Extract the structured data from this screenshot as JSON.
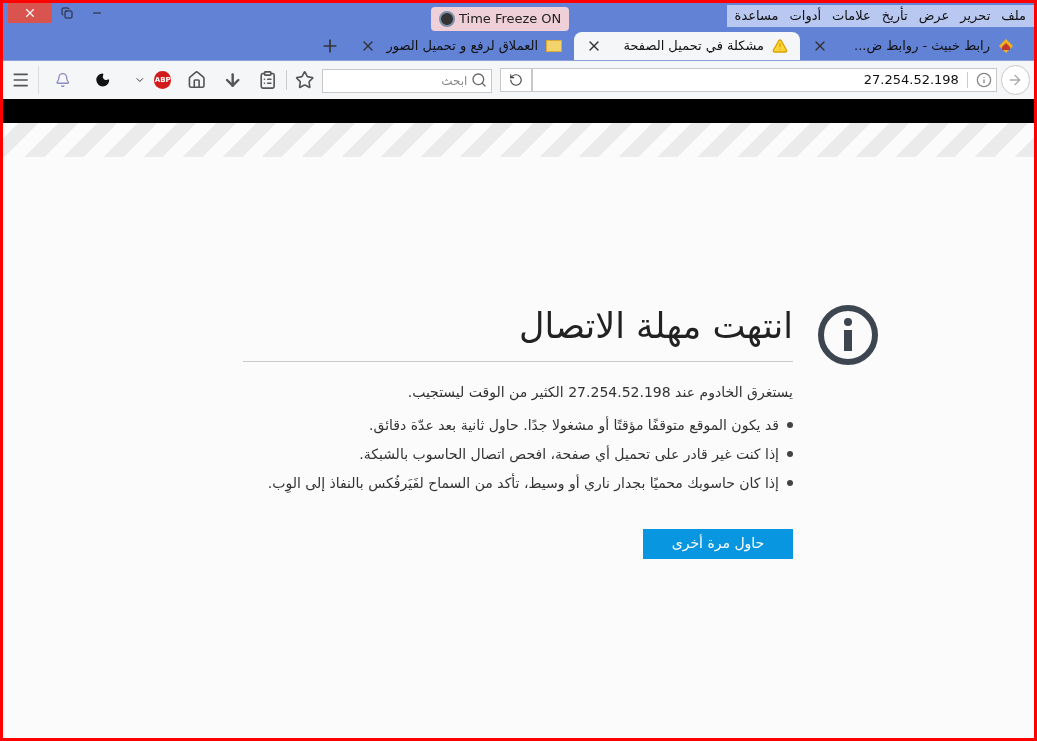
{
  "menu": [
    "ملف",
    "تحرير",
    "عرض",
    "تأريخ",
    "علامات",
    "أدوات",
    "مساعدة"
  ],
  "overlay": {
    "label": "Time Freeze",
    "state": "ON"
  },
  "tabs": [
    {
      "title": "رابط خبيث - روابط ض...",
      "selected": false,
      "kind": "site"
    },
    {
      "title": "مشكلة في تحميل الصفحة",
      "selected": true,
      "kind": "warning"
    },
    {
      "title": "العملاق لرفع و تحميل الصور",
      "selected": false,
      "kind": "banner"
    }
  ],
  "address_bar": {
    "url": "27.254.52.198"
  },
  "search": {
    "placeholder": "ابحث"
  },
  "toolbar": {
    "adblock_badge": "ABP"
  },
  "error": {
    "title": "انتهت مهلة الاتصال",
    "description": "يستغرق الخادوم عند 27.254.52.198 الكثير من الوقت ليستجيب.",
    "bullets": [
      "قد يكون الموقع متوقفًا مؤقتًا أو مشغولا جدًا. حاول ثانية بعد عدّة دقائق.",
      "إذا كنت غير قادر على تحميل أي صفحة، افحص اتصال الحاسوب بالشبكة.",
      "إذا كان حاسوبك محميًا بجدار ناري أو وسيط، تأكد من السماح لفَيَرفُكس بالنفاذ إلى الوِب."
    ],
    "button": "حاول مرة أخرى"
  }
}
